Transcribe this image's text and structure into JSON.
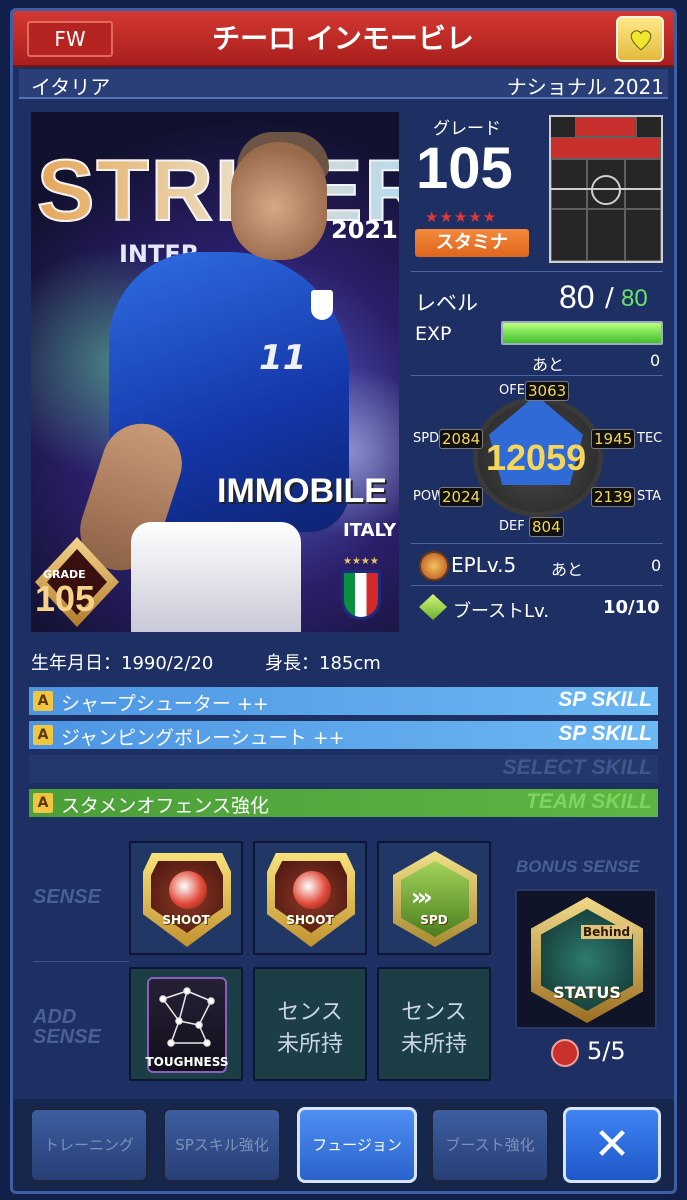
{
  "header": {
    "position": "FW",
    "player_name": "チーロ インモービレ",
    "favorite_icon": "heart-icon"
  },
  "subheader": {
    "country": "イタリア",
    "series": "ナショナル 2021"
  },
  "card": {
    "title_text": "STRIKER",
    "sub_text": "INTER",
    "year": "2021",
    "jersey_number": "11",
    "name_on_card": "IMMOBILE",
    "team_on_card": "ITALY",
    "crest_stars": "★★★★",
    "grade_label": "GRADE",
    "grade_value": "105"
  },
  "grade": {
    "label": "グレード",
    "value": "105",
    "stars": "★★★★★",
    "type": "スタミナ"
  },
  "level": {
    "label": "レベル",
    "current": "80",
    "separator": "/",
    "max": "80",
    "exp_label": "EXP",
    "exp_fill_percent": 100,
    "remaining_label": "あと",
    "remaining_value": "0"
  },
  "stats": {
    "total": "12059",
    "ofe_label": "OFE",
    "ofe": "3063",
    "spd_label": "SPD",
    "spd": "2084",
    "tec_label": "TEC",
    "tec": "1945",
    "pow_label": "POW",
    "pow": "2024",
    "sta_label": "STA",
    "sta": "2139",
    "def_label": "DEF",
    "def": "804"
  },
  "ep": {
    "label": "EPLv.5",
    "remaining_label": "あと",
    "remaining_value": "0"
  },
  "boost": {
    "label": "ブーストLv.",
    "value": "10/10"
  },
  "profile": {
    "birth": "生年月日：1990/2/20",
    "height": "身長：185cm"
  },
  "skills": [
    {
      "rank": "A",
      "name": "シャープシューター ++",
      "type": "SP SKILL"
    },
    {
      "rank": "A",
      "name": "ジャンピングボレーシュート ++",
      "type": "SP SKILL"
    },
    {
      "rank": "",
      "name": "",
      "type": "SELECT SKILL"
    },
    {
      "rank": "A",
      "name": "スタメンオフェンス強化",
      "type": "TEAM SKILL"
    }
  ],
  "sense": {
    "label": "SENSE",
    "add_label_1": "ADD",
    "add_label_2": "SENSE",
    "slots": [
      {
        "text": "SHOOT",
        "icon": "shoot-sense-icon"
      },
      {
        "text": "SHOOT",
        "icon": "shoot-sense-icon"
      },
      {
        "text": "SPD",
        "icon": "speed-sense-icon"
      }
    ],
    "add_slots": [
      {
        "text": "TOUGHNESS",
        "icon": "toughness-sense-icon"
      },
      {
        "line1": "センス",
        "line2": "未所持"
      },
      {
        "line1": "センス",
        "line2": "未所持"
      }
    ],
    "bonus_title": "BONUS SENSE",
    "bonus_behind": "Behind",
    "bonus_status": "STATUS",
    "bonus_count": "5/5"
  },
  "footer": {
    "training": "トレーニング",
    "sp_skill": "SPスキル強化",
    "fusion": "フュージョン",
    "boost": "ブースト強化",
    "close": "✕"
  }
}
